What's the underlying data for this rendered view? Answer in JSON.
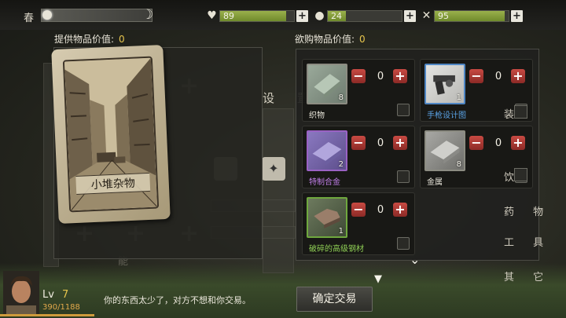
{
  "topbar": {
    "season": "春",
    "stats": [
      {
        "icon": "heart-icon",
        "value": "89",
        "level": 0.89
      },
      {
        "icon": "stomach-icon",
        "value": "24",
        "level": 0.24
      },
      {
        "icon": "utensils-icon",
        "value": "95",
        "level": 0.95
      }
    ]
  },
  "offer": {
    "label": "提供物品价值:",
    "value": "0",
    "card_title": "小堆杂物"
  },
  "want": {
    "label": "欲购物品价值:",
    "value": "0",
    "items": [
      {
        "name": "织物",
        "count": "8",
        "qty": "0",
        "name_color": "#e8e5da",
        "border": "#8c8c82"
      },
      {
        "name": "手枪设计图",
        "count": "1",
        "qty": "0",
        "name_color": "#5aa3e6",
        "border": "#4f86c4"
      },
      {
        "name": "特制合金",
        "count": "2",
        "qty": "0",
        "name_color": "#c07ee8",
        "border": "#9a62c4"
      },
      {
        "name": "金属",
        "count": "8",
        "qty": "0",
        "name_color": "#e8e5da",
        "border": "#8c8c82"
      },
      {
        "name": "破碎的高级钢材",
        "count": "1",
        "qty": "0",
        "name_color": "#8fcf55",
        "border": "#6fa83e"
      }
    ]
  },
  "categories": [
    "装",
    "饮",
    "药 物",
    "工 具",
    "其 它"
  ],
  "bg": {
    "settings": "设 置"
  },
  "player": {
    "lv_label": "Lv",
    "level": "7",
    "xp": "390/1188"
  },
  "message": "你的东西太少了，对方不想和你交易。",
  "confirm_button": "确定交易"
}
